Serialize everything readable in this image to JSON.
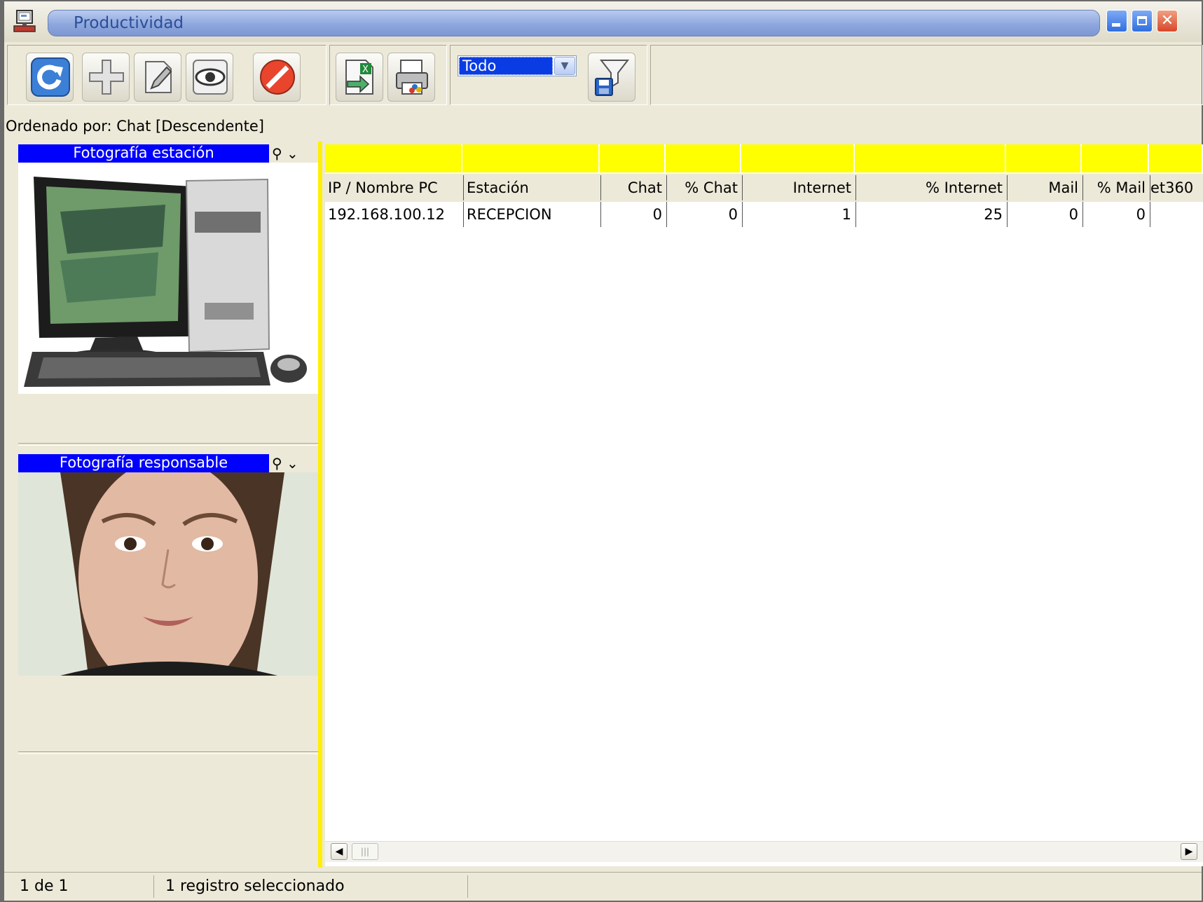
{
  "window": {
    "title": "Productividad"
  },
  "toolbar": {
    "buttons": [
      {
        "icon": "refresh-icon"
      },
      {
        "icon": "add-icon"
      },
      {
        "icon": "edit-icon"
      },
      {
        "icon": "view-icon"
      },
      {
        "icon": "cancel-icon"
      },
      {
        "icon": "export-excel-icon"
      },
      {
        "icon": "print-icon"
      },
      {
        "icon": "save-filter-icon"
      }
    ],
    "filter_select": {
      "value": "Todo"
    }
  },
  "sort_label": "Ordenado por: Chat [Descendente]",
  "left_panel": {
    "station_photo_title": "Fotografía estación",
    "responsible_photo_title": "Fotografía responsable"
  },
  "grid": {
    "columns": [
      {
        "header": "IP / Nombre PC"
      },
      {
        "header": "Estación"
      },
      {
        "header": "Chat"
      },
      {
        "header": "% Chat"
      },
      {
        "header": "Internet"
      },
      {
        "header": "% Internet"
      },
      {
        "header": "Mail"
      },
      {
        "header": "% Mail"
      },
      {
        "header": "et360"
      }
    ],
    "rows": [
      [
        "192.168.100.12",
        "RECEPCION",
        "0",
        "0",
        "1",
        "25",
        "0",
        "0",
        ""
      ]
    ]
  },
  "status": {
    "position": "1 de 1",
    "selection": "1 registro seleccionado"
  },
  "colors": {
    "title_text": "#2c4e98",
    "panel_header": "#0000ff",
    "filter_row": "#ffff00",
    "selection": "#0a3ce4"
  }
}
